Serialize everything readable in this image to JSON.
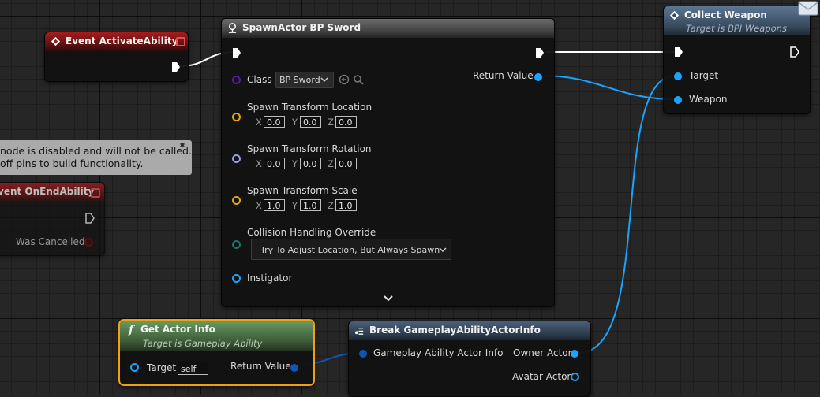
{
  "colors": {
    "exec_white": "#ffffff",
    "object_blue": "#1aa3ff",
    "class_purple": "#5a1aa0",
    "transform_yellow": "#e6a800",
    "rotation_lavender": "#9a9cf0",
    "enum_teal": "#0f7a68",
    "wire_dark_blue": "#1055b5",
    "selected_outline": "#f0a010"
  },
  "event_activate": {
    "title": "Event ActivateAbility"
  },
  "disabled_comment": {
    "line1": "node is disabled and will not be called.",
    "line2": "off pins to build functionality."
  },
  "event_end": {
    "title": "vent OnEndAbility",
    "was_cancelled": "Was Cancelled"
  },
  "spawn": {
    "title": "SpawnActor BP Sword",
    "class_label": "Class",
    "class_value": "BP Sword",
    "return_value": "Return Value",
    "location_label": "Spawn Transform Location",
    "rotation_label": "Spawn Transform Rotation",
    "scale_label": "Spawn Transform Scale",
    "axis": {
      "x": "X",
      "y": "Y",
      "z": "Z"
    },
    "location": {
      "x": "0.0",
      "y": "0.0",
      "z": "0.0"
    },
    "rotation": {
      "x": "0.0",
      "y": "0.0",
      "z": "0.0"
    },
    "scale": {
      "x": "1.0",
      "y": "1.0",
      "z": "1.0"
    },
    "collision_label": "Collision Handling Override",
    "collision_value": "Try To Adjust Location, But Always Spawn",
    "instigator_label": "Instigator"
  },
  "collect": {
    "title": "Collect Weapon",
    "subtitle": "Target is BPI Weapons",
    "target_label": "Target",
    "weapon_label": "Weapon"
  },
  "get_actor": {
    "title": "Get Actor Info",
    "subtitle": "Target is Gameplay Ability",
    "target_label": "Target",
    "target_value": "self",
    "return_value": "Return Value"
  },
  "break_node": {
    "title": "Break GameplayAbilityActorInfo",
    "input_label": "Gameplay Ability Actor Info",
    "owner_label": "Owner Actor",
    "avatar_label": "Avatar Actor"
  }
}
